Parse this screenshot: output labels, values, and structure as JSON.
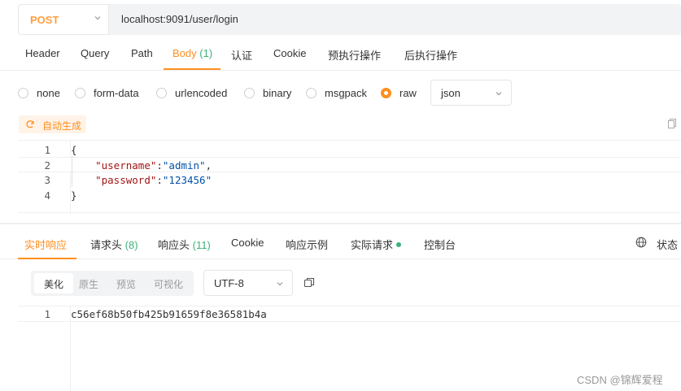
{
  "request": {
    "method": "POST",
    "url": "localhost:9091/user/login"
  },
  "request_tabs": [
    {
      "label": "Header"
    },
    {
      "label": "Query"
    },
    {
      "label": "Path"
    },
    {
      "label": "Body",
      "count": "(1)"
    },
    {
      "label": "认证"
    },
    {
      "label": "Cookie"
    },
    {
      "label": "预执行操作"
    },
    {
      "label": "后执行操作"
    }
  ],
  "active_request_tab": "Body",
  "body_types": [
    "none",
    "form-data",
    "urlencoded",
    "binary",
    "msgpack",
    "raw"
  ],
  "selected_body_type": "raw",
  "raw_format": "json",
  "auto_generate_label": "自动生成",
  "code_lines": [
    {
      "n": "1",
      "text": "{"
    },
    {
      "n": "2",
      "key": "\"username\"",
      "value": "\"admin\"",
      "trail": ","
    },
    {
      "n": "3",
      "key": "\"password\"",
      "value": "\"123456\"",
      "trail": ""
    },
    {
      "n": "4",
      "text": "}"
    }
  ],
  "response_tabs": [
    {
      "label": "实时响应"
    },
    {
      "label": "请求头",
      "count": "(8)"
    },
    {
      "label": "响应头",
      "count": "(11)"
    },
    {
      "label": "Cookie"
    },
    {
      "label": "响应示例"
    },
    {
      "label": "实际请求"
    },
    {
      "label": "控制台"
    }
  ],
  "active_response_tab": "实时响应",
  "status_label": "状态",
  "view_modes": [
    "美化",
    "原生",
    "预览",
    "可视化"
  ],
  "active_view_mode": "美化",
  "encoding": "UTF-8",
  "response_lines": [
    {
      "n": "1",
      "text": "c56ef68b50fb425b91659f8e36581b4a"
    }
  ],
  "watermark": "CSDN @锦辉爱程",
  "colors": {
    "accent": "#ff8f1f",
    "method": "#ff9f40",
    "count": "#3bb27a"
  }
}
